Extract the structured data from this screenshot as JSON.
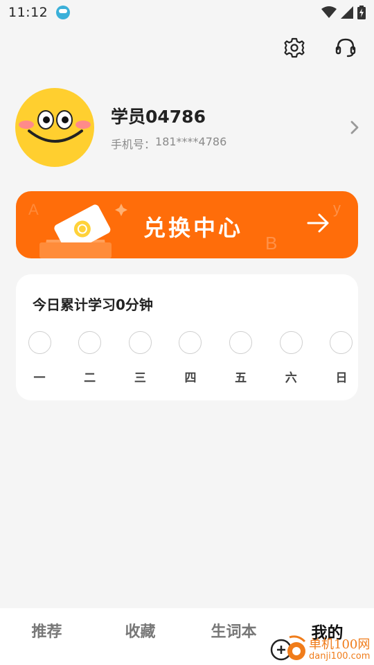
{
  "status_bar": {
    "time": "11:12",
    "app_icon": "app-notification-icon",
    "icons": [
      "wifi-icon",
      "signal-icon",
      "battery-charging-icon"
    ]
  },
  "header": {
    "icons": [
      "settings-gear-icon",
      "customer-service-headset-icon"
    ]
  },
  "profile": {
    "name": "学员04786",
    "phone_label": "手机号：",
    "phone": "181****4786",
    "avatar": "smiley-face-avatar"
  },
  "exchange_banner": {
    "title": "兑换中心",
    "background_color": "#ff6d0a",
    "arrow_icon": "arrow-right-icon"
  },
  "study_card": {
    "title": "今日累计学习0分钟",
    "days": [
      "一",
      "二",
      "三",
      "四",
      "五",
      "六",
      "日"
    ]
  },
  "bottom_nav": {
    "tabs": [
      {
        "label": "推荐",
        "active": false
      },
      {
        "label": "收藏",
        "active": false
      },
      {
        "label": "生词本",
        "active": false
      },
      {
        "label": "我的",
        "active": true
      }
    ]
  },
  "watermark": {
    "line1": "单机100网",
    "line2": "danji100.com"
  }
}
